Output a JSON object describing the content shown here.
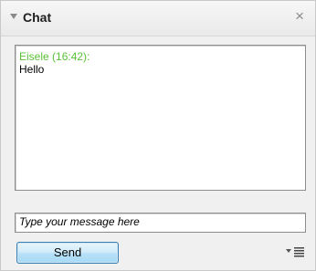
{
  "header": {
    "title": "Chat",
    "collapse_icon": "triangle-down-icon",
    "close_glyph": "×"
  },
  "messages": [
    {
      "sender_line": "Eisele (16:42):",
      "text": "Hello",
      "sender_color": "#59c237"
    }
  ],
  "composer": {
    "placeholder": "Type your message here",
    "value": "",
    "send_label": "Send",
    "options_icon": "menu-list-icon"
  },
  "colors": {
    "panel_bg": "#f0f0f0",
    "button_border": "#3c7fb1",
    "button_fill": "#b7e0f7"
  }
}
